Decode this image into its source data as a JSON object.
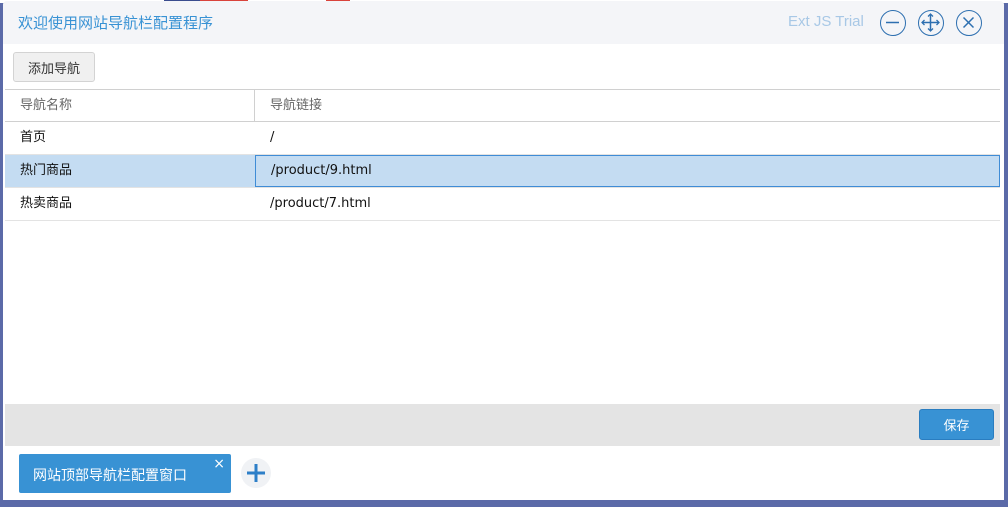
{
  "window": {
    "title": "欢迎使用网站导航栏配置程序",
    "trial_text": "Ext JS Trial",
    "tools": [
      "minimize-icon",
      "maximize-icon",
      "close-icon"
    ]
  },
  "toolbar": {
    "add_label": "添加导航"
  },
  "grid": {
    "columns": [
      "导航名称",
      "导航链接"
    ],
    "rows": [
      {
        "name": "首页",
        "link": "/"
      },
      {
        "name": "热门商品",
        "link": "/product/9.html"
      },
      {
        "name": "热卖商品",
        "link": "/product/7.html"
      }
    ],
    "selected_row": 1
  },
  "footer": {
    "save_label": "保存"
  },
  "taskbar": {
    "tab_label": "网站顶部导航栏配置窗口",
    "tab_close": "×"
  },
  "colors": {
    "accent": "#3892d4",
    "selected_row": "#c4dcf2",
    "background": "#5b6aa8"
  }
}
